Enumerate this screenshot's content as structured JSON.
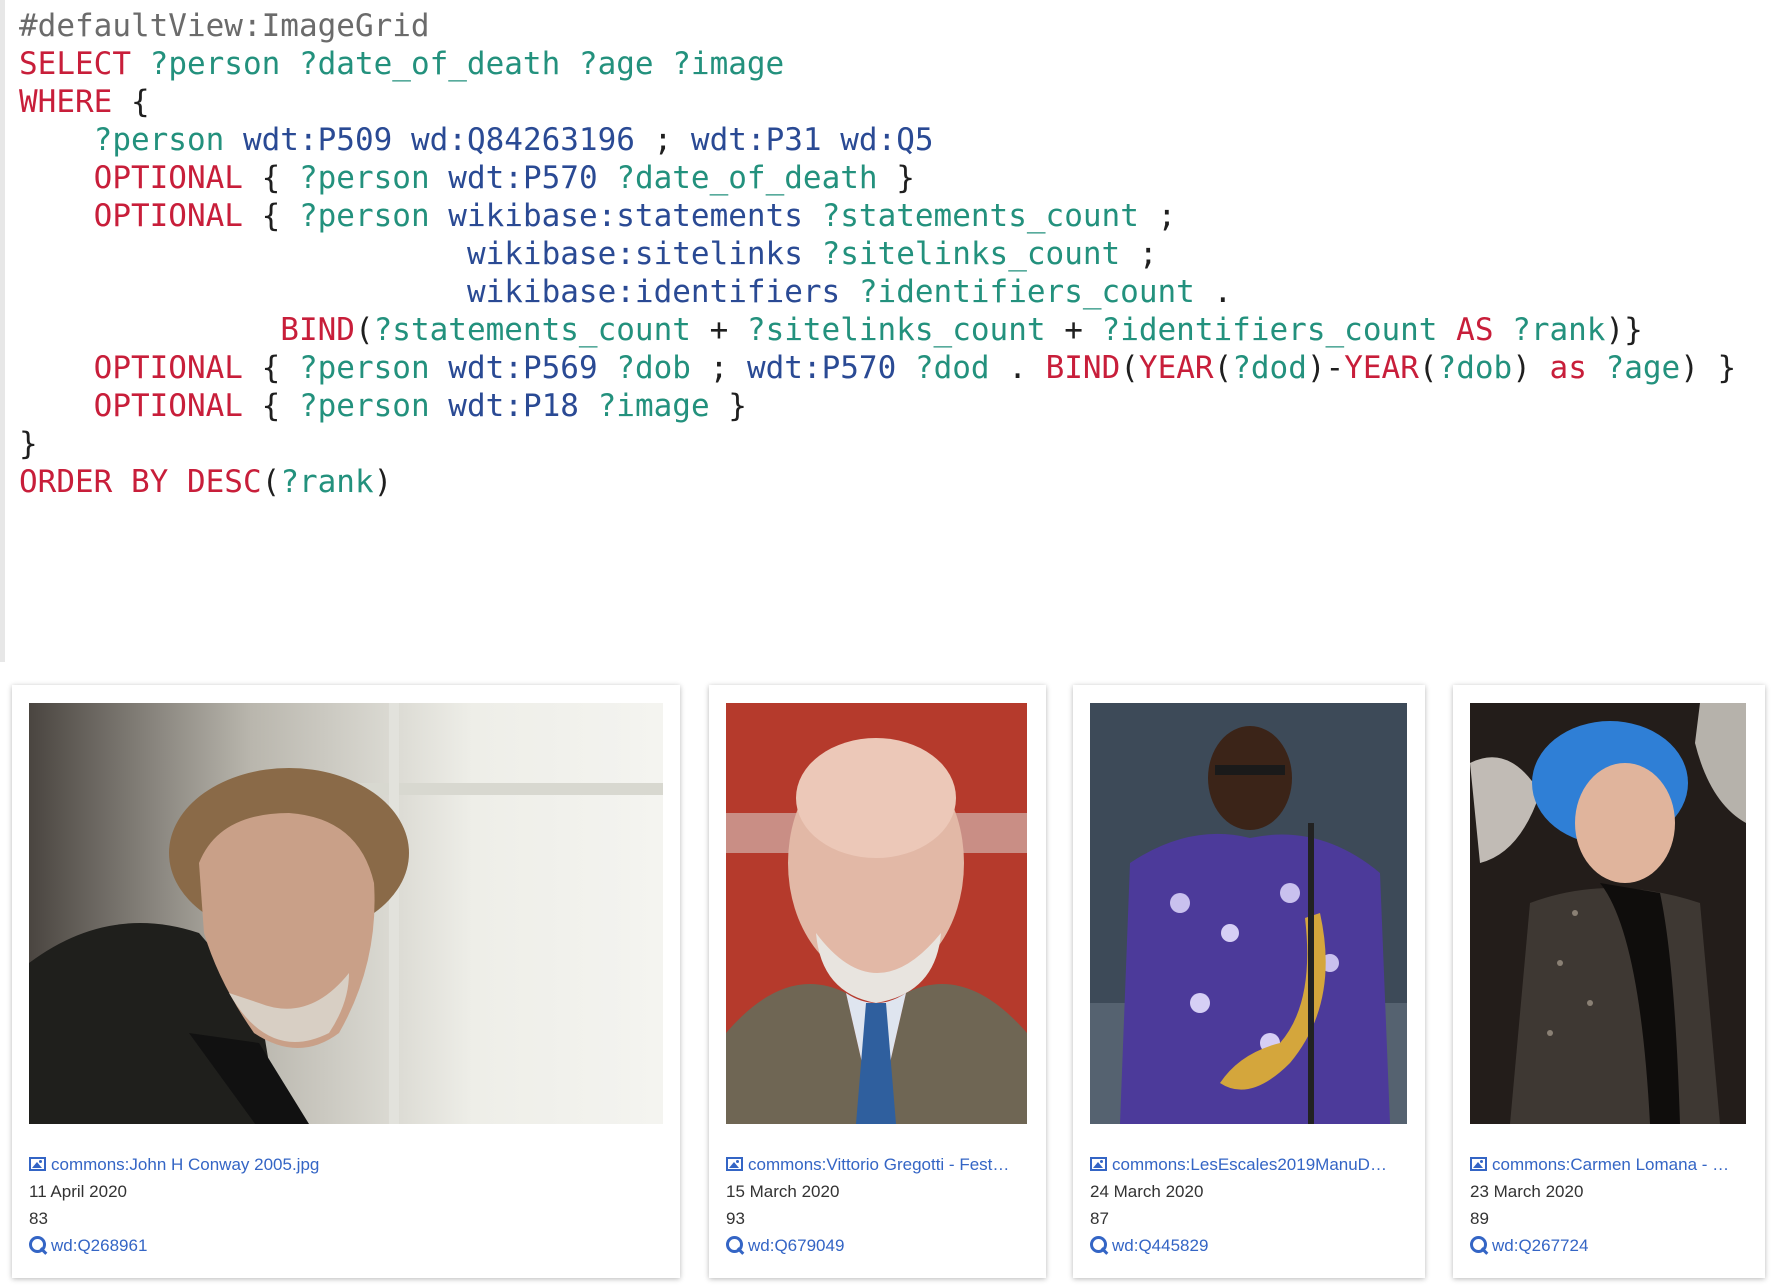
{
  "query": {
    "lines": [
      [
        {
          "t": "#defaultView:ImageGrid",
          "c": "cm"
        }
      ],
      [
        {
          "t": "SELECT",
          "c": "kw"
        },
        {
          "t": " "
        },
        {
          "t": "?person ?date_of_death ?age ?image",
          "c": "var"
        }
      ],
      [
        {
          "t": "WHERE",
          "c": "kw"
        },
        {
          "t": " {",
          "c": "op"
        }
      ],
      [
        {
          "t": "    "
        },
        {
          "t": "?person",
          "c": "var"
        },
        {
          "t": " "
        },
        {
          "t": "wdt:P509 wd:Q84263196",
          "c": "iri"
        },
        {
          "t": " ; ",
          "c": "op"
        },
        {
          "t": "wdt:P31 wd:Q5",
          "c": "iri"
        }
      ],
      [
        {
          "t": "    "
        },
        {
          "t": "OPTIONAL",
          "c": "kw"
        },
        {
          "t": " { ",
          "c": "op"
        },
        {
          "t": "?person",
          "c": "var"
        },
        {
          "t": " "
        },
        {
          "t": "wdt:P570",
          "c": "iri"
        },
        {
          "t": " "
        },
        {
          "t": "?date_of_death",
          "c": "var"
        },
        {
          "t": " }",
          "c": "op"
        }
      ],
      [
        {
          "t": "    "
        },
        {
          "t": "OPTIONAL",
          "c": "kw"
        },
        {
          "t": " { ",
          "c": "op"
        },
        {
          "t": "?person",
          "c": "var"
        },
        {
          "t": " "
        },
        {
          "t": "wikibase:statements",
          "c": "iri"
        },
        {
          "t": " "
        },
        {
          "t": "?statements_count",
          "c": "var"
        },
        {
          "t": " ;",
          "c": "op"
        }
      ],
      [
        {
          "t": "                        "
        },
        {
          "t": "wikibase:sitelinks",
          "c": "iri"
        },
        {
          "t": " "
        },
        {
          "t": "?sitelinks_count",
          "c": "var"
        },
        {
          "t": " ;",
          "c": "op"
        }
      ],
      [
        {
          "t": "                        "
        },
        {
          "t": "wikibase:identifiers",
          "c": "iri"
        },
        {
          "t": " "
        },
        {
          "t": "?identifiers_count",
          "c": "var"
        },
        {
          "t": " .",
          "c": "op"
        }
      ],
      [
        {
          "t": "              "
        },
        {
          "t": "BIND",
          "c": "kw"
        },
        {
          "t": "(",
          "c": "op"
        },
        {
          "t": "?statements_count",
          "c": "var"
        },
        {
          "t": " + ",
          "c": "op"
        },
        {
          "t": "?sitelinks_count",
          "c": "var"
        },
        {
          "t": " + ",
          "c": "op"
        },
        {
          "t": "?identifiers_count",
          "c": "var"
        },
        {
          "t": " "
        },
        {
          "t": "AS",
          "c": "kw"
        },
        {
          "t": " "
        },
        {
          "t": "?rank",
          "c": "var"
        },
        {
          "t": ")}",
          "c": "op"
        }
      ],
      [
        {
          "t": "    "
        },
        {
          "t": "OPTIONAL",
          "c": "kw"
        },
        {
          "t": " { ",
          "c": "op"
        },
        {
          "t": "?person",
          "c": "var"
        },
        {
          "t": " "
        },
        {
          "t": "wdt:P569",
          "c": "iri"
        },
        {
          "t": " "
        },
        {
          "t": "?dob",
          "c": "var"
        },
        {
          "t": " ; ",
          "c": "op"
        },
        {
          "t": "wdt:P570",
          "c": "iri"
        },
        {
          "t": " "
        },
        {
          "t": "?dod",
          "c": "var"
        },
        {
          "t": " . ",
          "c": "op"
        },
        {
          "t": "BIND",
          "c": "kw"
        },
        {
          "t": "(",
          "c": "op"
        },
        {
          "t": "YEAR",
          "c": "kw"
        },
        {
          "t": "(",
          "c": "op"
        },
        {
          "t": "?dod",
          "c": "var"
        },
        {
          "t": ")-",
          "c": "op"
        },
        {
          "t": "YEAR",
          "c": "kw"
        },
        {
          "t": "(",
          "c": "op"
        },
        {
          "t": "?dob",
          "c": "var"
        },
        {
          "t": ") ",
          "c": "op"
        },
        {
          "t": "as",
          "c": "kw"
        },
        {
          "t": " "
        },
        {
          "t": "?age",
          "c": "var"
        },
        {
          "t": ") }",
          "c": "op"
        }
      ],
      [
        {
          "t": "    "
        },
        {
          "t": "OPTIONAL",
          "c": "kw"
        },
        {
          "t": " { ",
          "c": "op"
        },
        {
          "t": "?person",
          "c": "var"
        },
        {
          "t": " "
        },
        {
          "t": "wdt:P18",
          "c": "iri"
        },
        {
          "t": " "
        },
        {
          "t": "?image",
          "c": "var"
        },
        {
          "t": " }",
          "c": "op"
        }
      ],
      [
        {
          "t": "}",
          "c": "op"
        }
      ],
      [
        {
          "t": "ORDER BY DESC",
          "c": "kw"
        },
        {
          "t": "(",
          "c": "op"
        },
        {
          "t": "?rank",
          "c": "var"
        },
        {
          "t": ")",
          "c": "op"
        }
      ]
    ]
  },
  "results": [
    {
      "image_link": "commons:John H Conway 2005.jpg",
      "date_of_death": "11 April 2020",
      "age": "83",
      "person_link": "wd:Q268961",
      "photo_icon": "portrait-photo"
    },
    {
      "image_link": "commons:Vittorio Gregotti - Fest…",
      "date_of_death": "15 March 2020",
      "age": "93",
      "person_link": "wd:Q679049",
      "photo_icon": "portrait-photo"
    },
    {
      "image_link": "commons:LesEscales2019ManuD…",
      "date_of_death": "24 March 2020",
      "age": "87",
      "person_link": "wd:Q445829",
      "photo_icon": "portrait-photo"
    },
    {
      "image_link": "commons:Carmen Lomana - …",
      "date_of_death": "23 March 2020",
      "age": "89",
      "person_link": "wd:Q267724",
      "photo_icon": "portrait-photo"
    }
  ],
  "colors": {
    "keyword": "#c81e3a",
    "variable": "#23917d",
    "iri": "#2a4a94",
    "comment": "#6b6b6b",
    "link": "#3465c5"
  }
}
